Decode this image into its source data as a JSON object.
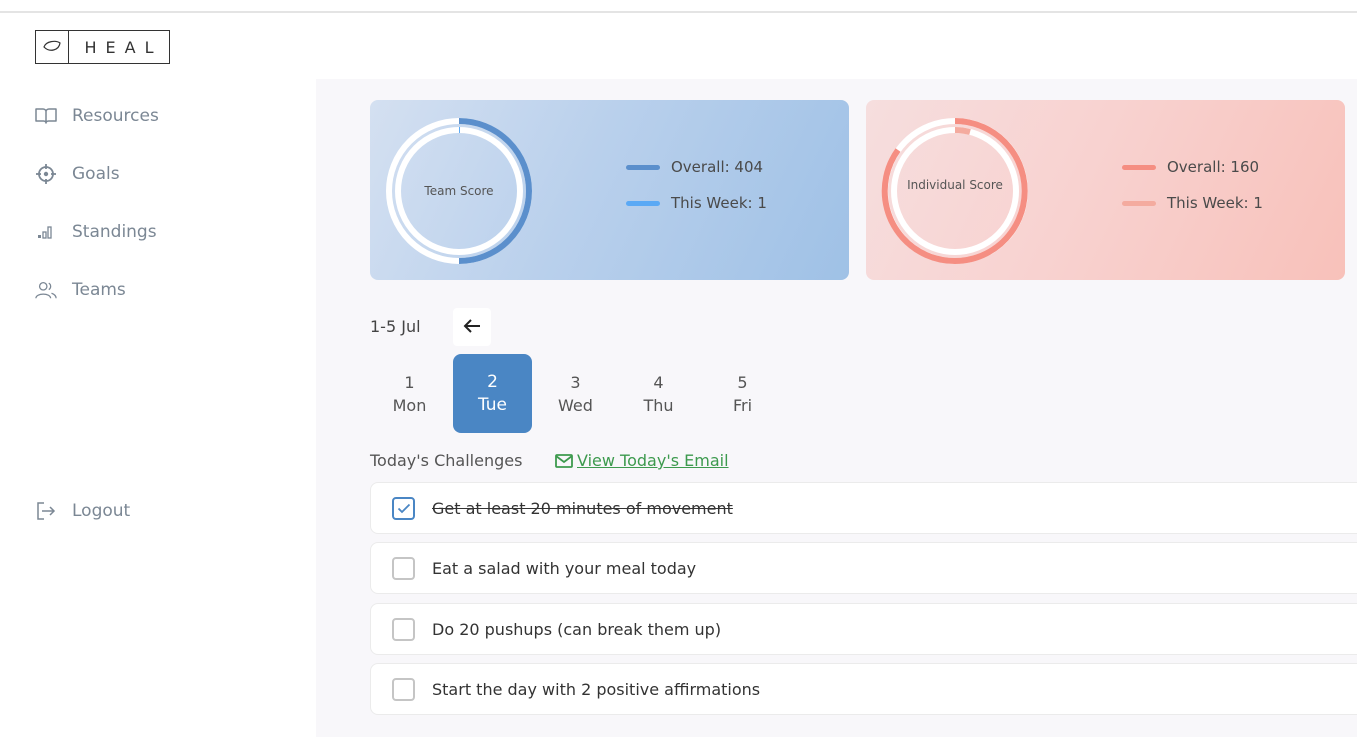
{
  "brand": {
    "name": "HEAL"
  },
  "sidebar": {
    "items": [
      {
        "label": "Resources",
        "icon": "book-icon"
      },
      {
        "label": "Goals",
        "icon": "crosshair-icon"
      },
      {
        "label": "Standings",
        "icon": "bar-chart-icon"
      },
      {
        "label": "Teams",
        "icon": "users-icon"
      }
    ],
    "logout": {
      "label": "Logout",
      "icon": "logout-icon"
    }
  },
  "team_score": {
    "label": "Team Score",
    "overall_label": "Overall: 404",
    "week_label": "This Week: 1",
    "overall_color": "#5b8fcc",
    "week_color": "#5aa9f5"
  },
  "individual_score": {
    "label": "Individual Score",
    "overall_label": "Overall: 160",
    "week_label": "This Week: 1",
    "overall_color": "#f58e82",
    "week_color": "#f4ab9f"
  },
  "week": {
    "range_label": "1-5 Jul",
    "days": [
      {
        "num": "1",
        "name": "Mon"
      },
      {
        "num": "2",
        "name": "Tue",
        "active": true
      },
      {
        "num": "3",
        "name": "Wed"
      },
      {
        "num": "4",
        "name": "Thu"
      },
      {
        "num": "5",
        "name": "Fri"
      }
    ]
  },
  "challenges": {
    "title": "Today's Challenges",
    "email_link": "View Today's Email",
    "items": [
      {
        "text": "Get at least 20 minutes of movement",
        "done": true
      },
      {
        "text": "Eat a salad with your meal today",
        "done": false
      },
      {
        "text": "Do 20 pushups (can break them up)",
        "done": false
      },
      {
        "text": "Start the day with 2 positive affirmations",
        "done": false
      }
    ]
  }
}
